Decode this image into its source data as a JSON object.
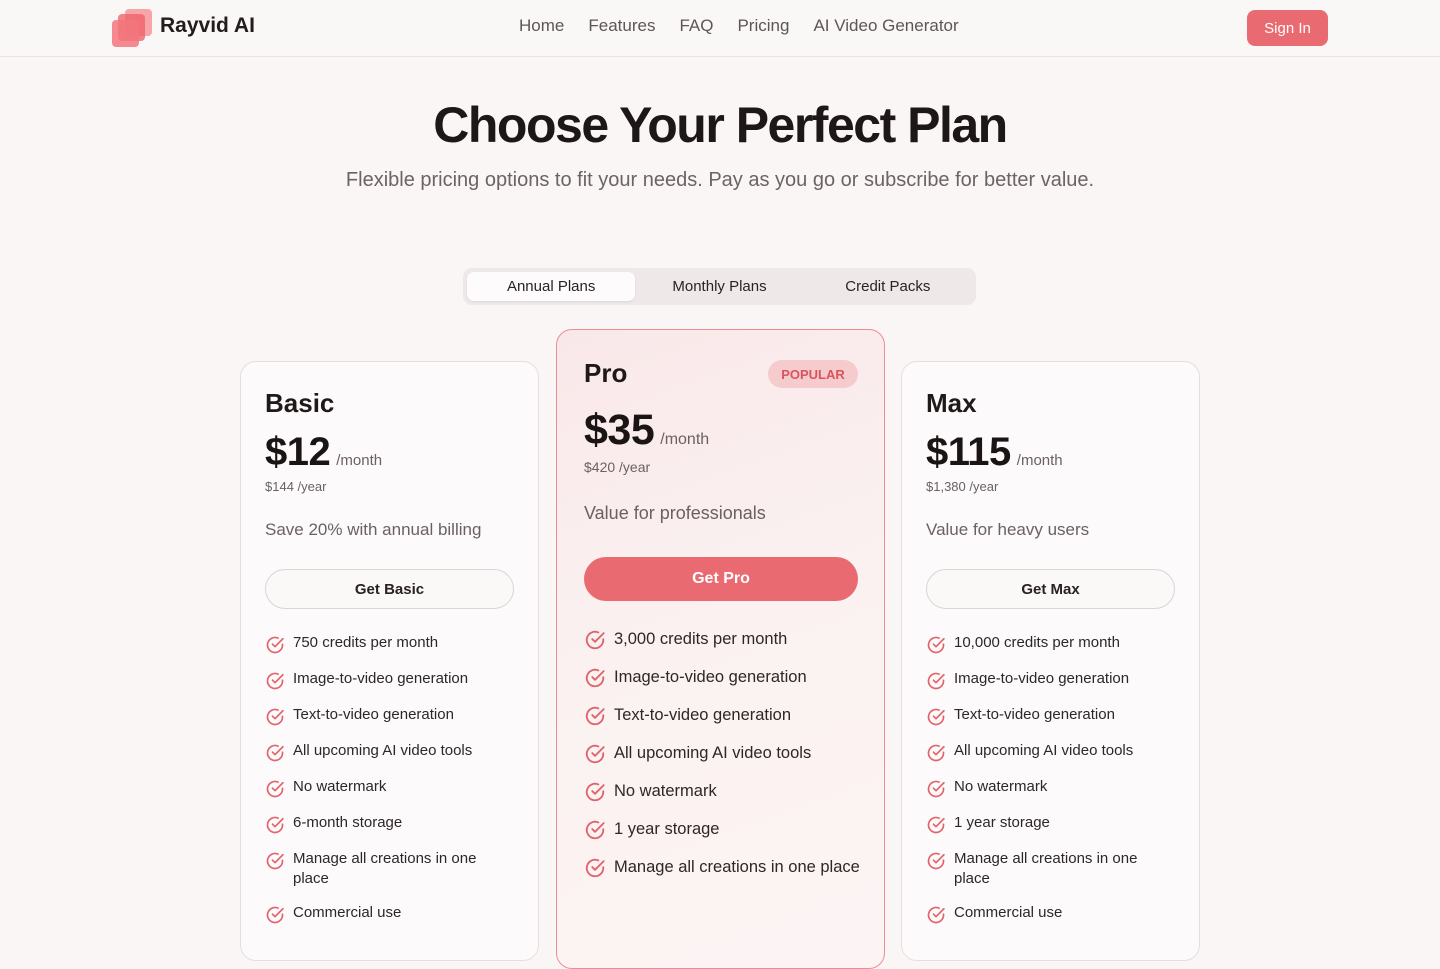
{
  "nav": {
    "brand": "Rayvid AI",
    "logo_icon": "stacked-squares-logo-icon",
    "links": [
      "Home",
      "Features",
      "FAQ",
      "Pricing",
      "AI Video Generator"
    ],
    "sign_in": "Sign In"
  },
  "hero": {
    "title": "Choose Your Perfect Plan",
    "subtitle": "Flexible pricing options to fit your needs. Pay as you go or subscribe for better value."
  },
  "tabs": {
    "items": [
      "Annual Plans",
      "Monthly Plans",
      "Credit Packs"
    ],
    "active": "Annual Plans"
  },
  "plans": {
    "basic": {
      "name": "Basic",
      "price": "$12",
      "per": "/month",
      "yearly": "$144 /year",
      "tagline": "Save 20% with annual billing",
      "button": "Get Basic",
      "features": [
        "750 credits per month",
        "Image-to-video generation",
        "Text-to-video generation",
        "All upcoming AI video tools",
        "No watermark",
        "6-month storage",
        "Manage all creations in one place",
        "Commercial use"
      ]
    },
    "pro": {
      "name": "Pro",
      "badge": "POPULAR",
      "price": "$35",
      "per": "/month",
      "yearly": "$420 /year",
      "tagline": "Value for professionals",
      "button": "Get Pro",
      "features": [
        "3,000 credits per month",
        "Image-to-video generation",
        "Text-to-video generation",
        "All upcoming AI video tools",
        "No watermark",
        "1 year storage",
        "Manage all creations in one place"
      ]
    },
    "max": {
      "name": "Max",
      "price": "$115",
      "per": "/month",
      "yearly": "$1,380 /year",
      "tagline": "Value for heavy users",
      "button": "Get Max",
      "features": [
        "10,000 credits per month",
        "Image-to-video generation",
        "Text-to-video generation",
        "All upcoming AI video tools",
        "No watermark",
        "1 year storage",
        "Manage all creations in one place",
        "Commercial use"
      ]
    }
  },
  "colors": {
    "accent": "#ea6a72",
    "background": "#faf6f6",
    "badge_bg": "#f6cbcd"
  },
  "icons": {
    "feature_check": "check-circle-icon"
  }
}
